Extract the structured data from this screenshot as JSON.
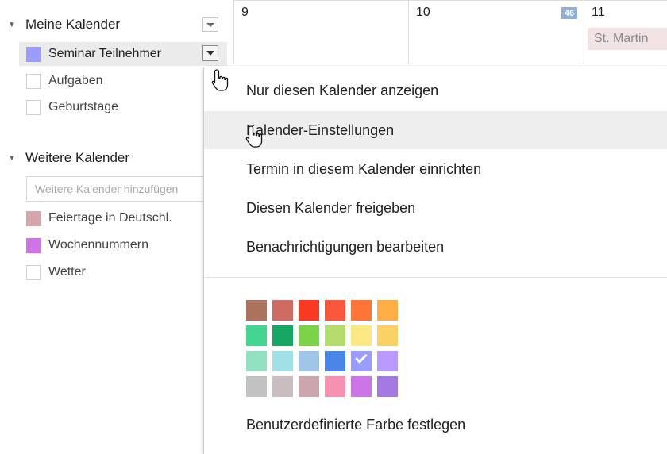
{
  "sidebar": {
    "my_calendars": {
      "title": "Meine Kalender",
      "items": [
        {
          "label": "Seminar Teilnehmer",
          "color": "#9a9cff",
          "selected": true
        },
        {
          "label": "Aufgaben",
          "color": ""
        },
        {
          "label": "Geburtstage",
          "color": ""
        }
      ]
    },
    "other_calendars": {
      "title": "Weitere Kalender",
      "add_placeholder": "Weitere Kalender hinzufügen",
      "items": [
        {
          "label": "Feiertage in Deutschl.",
          "color": "#d4a6ac"
        },
        {
          "label": "Wochennummern",
          "color": "#cd74e6"
        },
        {
          "label": "Wetter",
          "color": ""
        }
      ]
    }
  },
  "grid": {
    "days": [
      {
        "number": "9"
      },
      {
        "number": "10",
        "week_badge": "46"
      },
      {
        "number": "11",
        "event": "St. Martin"
      }
    ]
  },
  "menu": {
    "items": [
      "Nur diesen Kalender anzeigen",
      "Kalender-Einstellungen",
      "Termin in diesem Kalender einrichten",
      "Diesen Kalender freigeben",
      "Benachrichtigungen bearbeiten"
    ],
    "hovered_index": 1,
    "swatch_rows": [
      [
        "#ac725e",
        "#d06b64",
        "#f83a22",
        "#fa573c",
        "#ff7537",
        "#ffad46"
      ],
      [
        "#42d692",
        "#16a765",
        "#7bd148",
        "#b3dc6c",
        "#fbe983",
        "#fad165"
      ],
      [
        "#92e1c0",
        "#9fe1e7",
        "#9fc6e7",
        "#4986e7",
        "#9a9cff",
        "#b99aff"
      ],
      [
        "#c2c2c2",
        "#cabdbf",
        "#cca6ac",
        "#f691b2",
        "#cd74e6",
        "#a47ae2"
      ]
    ],
    "selected_swatch": "#9a9cff",
    "custom_color_label": "Benutzerdefinierte Farbe festlegen"
  },
  "icons": {
    "collapse_caret": "caret-down-icon",
    "dropdown": "dropdown-arrow-icon",
    "cursor": "hand-pointer-icon",
    "check": "checkmark-icon"
  }
}
